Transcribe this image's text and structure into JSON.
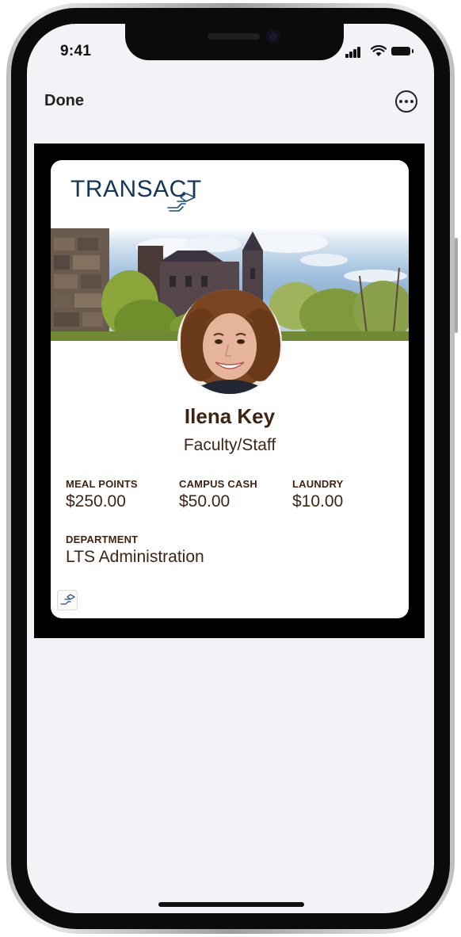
{
  "status_bar": {
    "time": "9:41",
    "icons": [
      "signal-icon",
      "wifi-icon",
      "battery-icon"
    ]
  },
  "nav": {
    "done_label": "Done",
    "more_icon": "ellipsis-circle-icon"
  },
  "pass": {
    "brand": "TRANSACT",
    "brand_color": "#15365a",
    "text_color": "#3f2412",
    "holder_name": "Ilena Key",
    "holder_role": "Faculty/Staff",
    "fields": [
      {
        "label": "MEAL POINTS",
        "value": "$250.00"
      },
      {
        "label": "CAMPUS CASH",
        "value": "$50.00"
      },
      {
        "label": "LAUNDRY",
        "value": "$10.00"
      }
    ],
    "department": {
      "label": "DEPARTMENT",
      "value": "LTS Administration"
    }
  }
}
